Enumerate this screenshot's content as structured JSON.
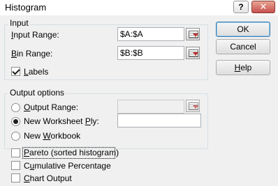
{
  "window": {
    "title": "Histogram",
    "help_button": "?",
    "close_button": "✕"
  },
  "input": {
    "group_label": "Input",
    "input_range_label": "Input Range:",
    "input_range_value": "$A:$A",
    "bin_range_label": "Bin Range:",
    "bin_range_value": "$B:$B",
    "labels_label": "Labels",
    "labels_checked": true
  },
  "output": {
    "group_label": "Output options",
    "output_range_label": "Output Range:",
    "output_range_value": "",
    "new_worksheet_label": "New Worksheet Ply:",
    "new_worksheet_value": "",
    "new_workbook_label": "New Workbook",
    "selected": "new_worksheet"
  },
  "options": {
    "pareto_label": "Pareto (sorted histogram)",
    "cumulative_label": "Cumulative Percentage",
    "chart_label": "Chart Output"
  },
  "buttons": {
    "ok": "OK",
    "cancel": "Cancel",
    "help": "Help"
  }
}
